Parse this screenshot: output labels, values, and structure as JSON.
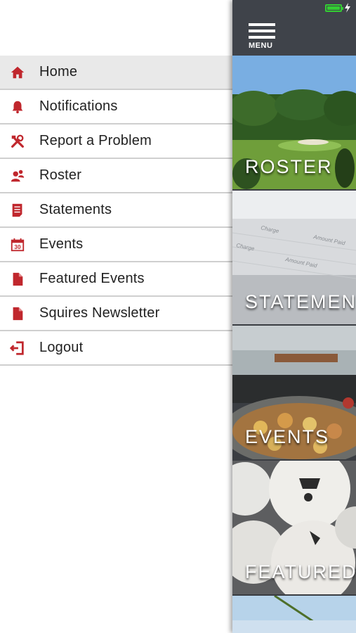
{
  "menu": {
    "items": [
      {
        "label": "Home",
        "icon": "home-icon",
        "active": true
      },
      {
        "label": "Notifications",
        "icon": "bell-icon",
        "active": false
      },
      {
        "label": "Report a Problem",
        "icon": "tools-icon",
        "active": false
      },
      {
        "label": "Roster",
        "icon": "roster-people-icon",
        "active": false
      },
      {
        "label": "Statements",
        "icon": "statement-document-icon",
        "active": false
      },
      {
        "label": "Events",
        "icon": "calendar-icon",
        "active": false
      },
      {
        "label": "Featured Events",
        "icon": "file-icon",
        "active": false
      },
      {
        "label": "Squires Newsletter",
        "icon": "file-icon",
        "active": false
      },
      {
        "label": "Logout",
        "icon": "logout-icon",
        "active": false
      }
    ],
    "calendar_day": "30"
  },
  "header": {
    "menu_label": "MENU"
  },
  "tiles": [
    {
      "caption": "ROSTER"
    },
    {
      "caption": "STATEMEN"
    },
    {
      "caption": "EVENTS"
    },
    {
      "caption": "FEATURED"
    }
  ],
  "colors": {
    "accent": "#c0272d",
    "panel": "#3a3d42",
    "battery": "#33cc33"
  }
}
